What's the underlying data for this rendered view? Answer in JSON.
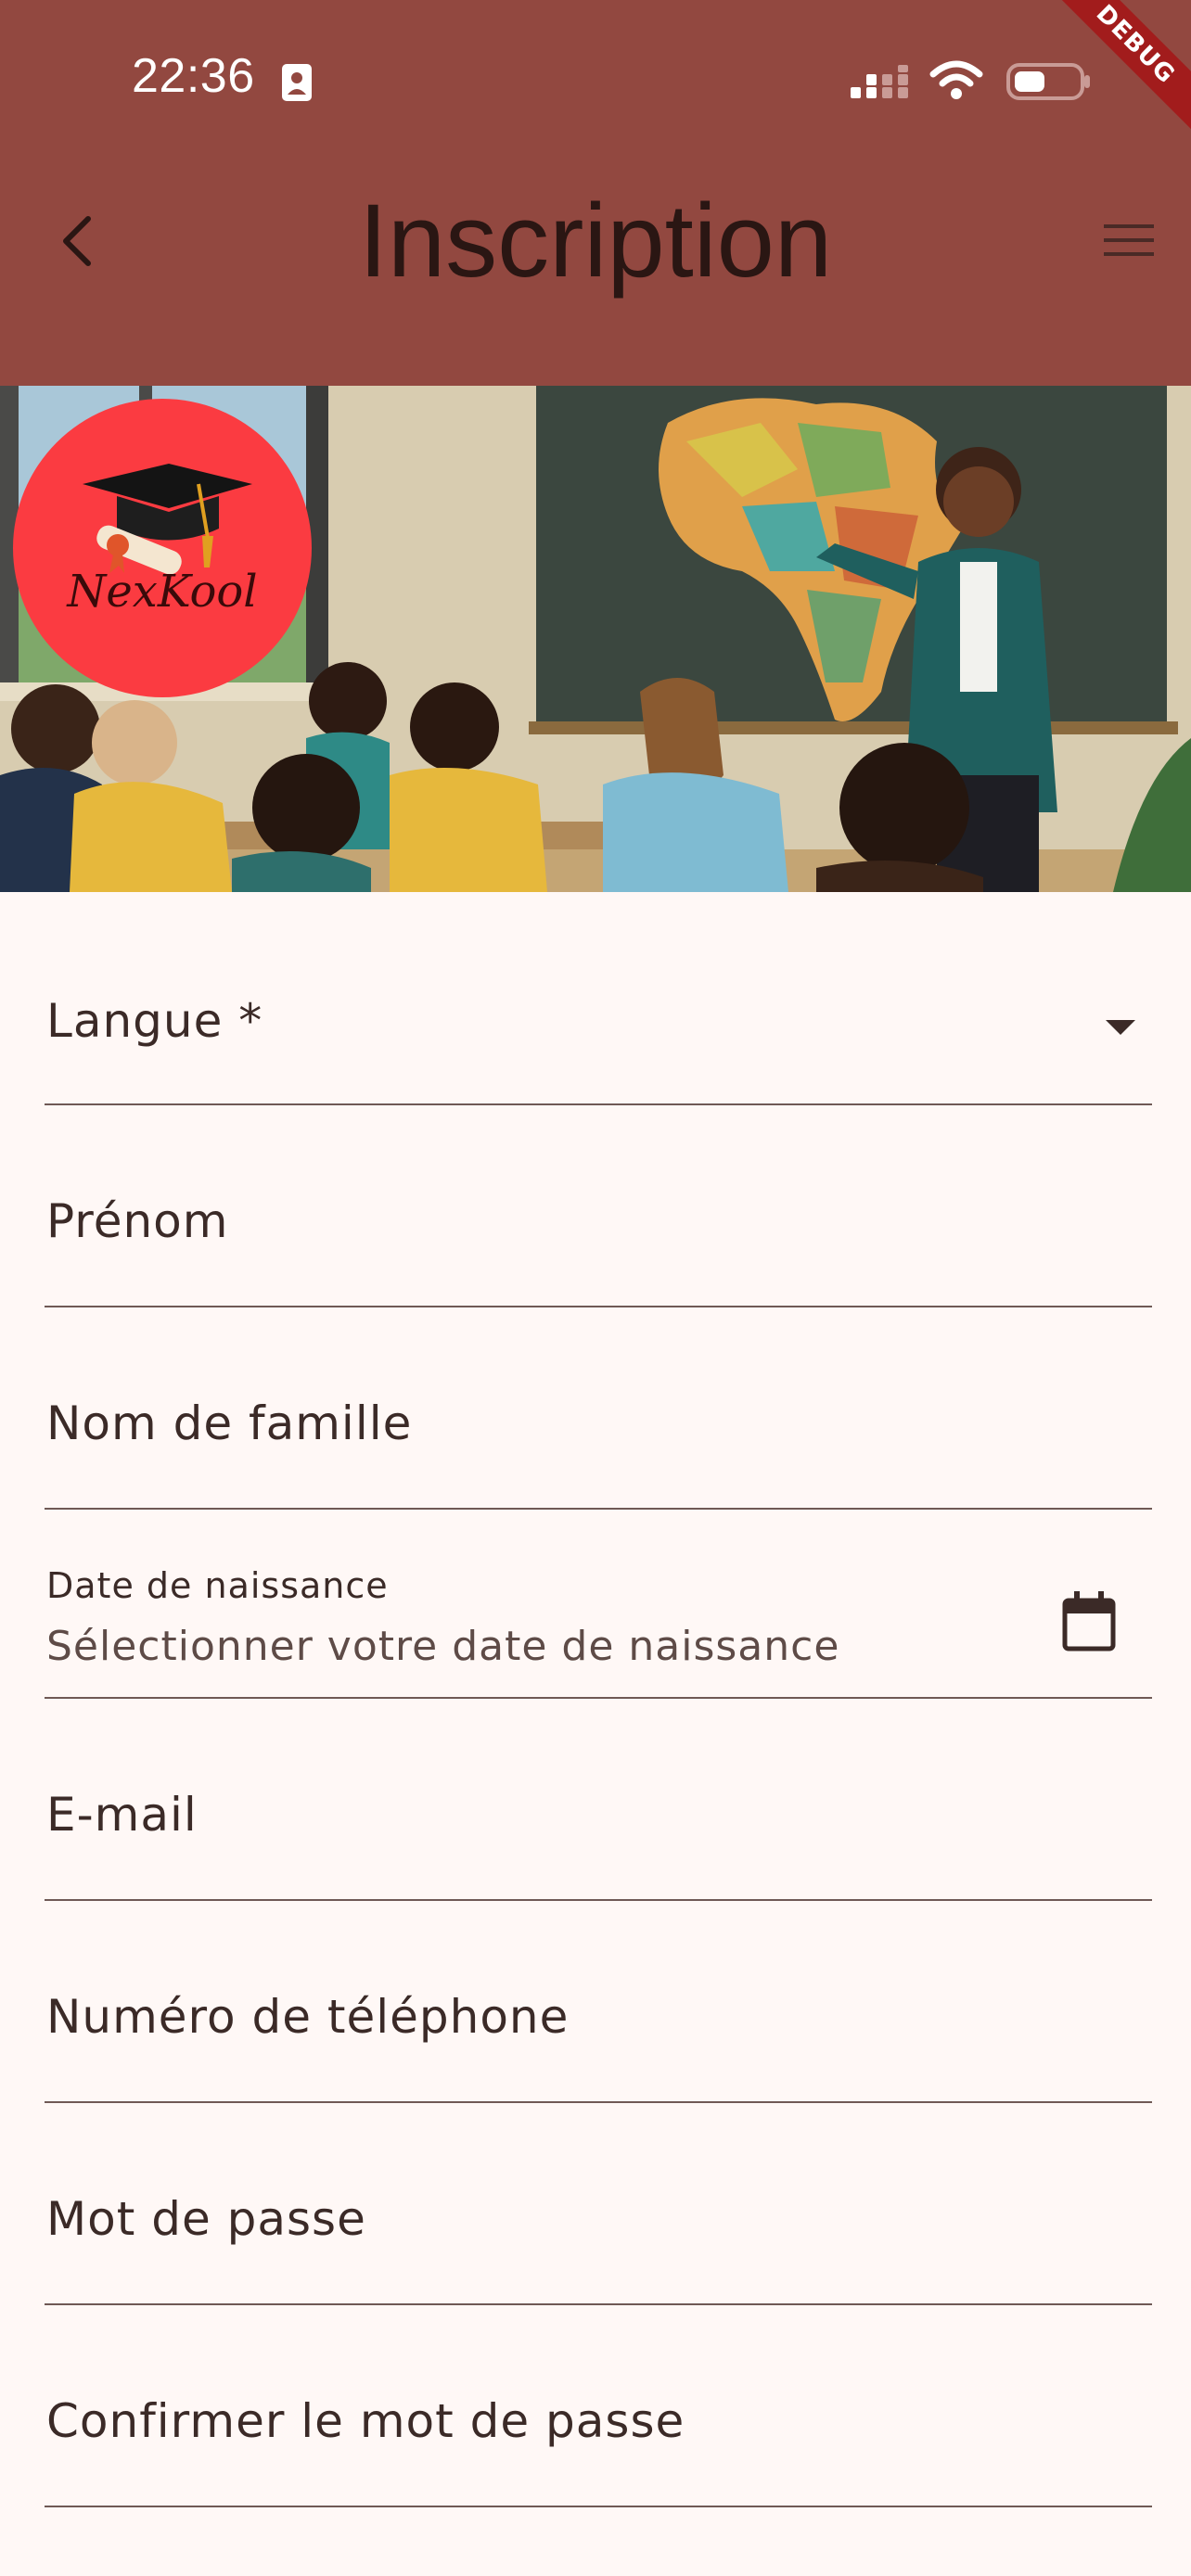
{
  "status_bar": {
    "time": "22:36",
    "icons": [
      "id-card-icon",
      "cellular-signal-icon",
      "wifi-icon",
      "battery-icon"
    ]
  },
  "debug_banner": "DEBUG",
  "app_bar": {
    "title": "Inscription",
    "back_icon": "chevron-left-icon",
    "menu_icon": "hamburger-menu-icon",
    "background_color": "#924840"
  },
  "hero": {
    "image": "classroom-teacher-africa-map",
    "logo_text": "NexKool",
    "logo_color": "#fb3b41"
  },
  "form": {
    "language": {
      "label": "Langue *",
      "icon": "dropdown-arrow-icon"
    },
    "first_name": {
      "label": "Prénom"
    },
    "last_name": {
      "label": "Nom de famille"
    },
    "birth_date": {
      "label": "Date de naissance",
      "placeholder": "Sélectionner votre date de naissance",
      "icon": "calendar-icon"
    },
    "email": {
      "label": "E-mail"
    },
    "phone": {
      "label": "Numéro de téléphone"
    },
    "password": {
      "label": "Mot de passe"
    },
    "confirm_password": {
      "label": "Confirmer le mot de passe"
    }
  }
}
